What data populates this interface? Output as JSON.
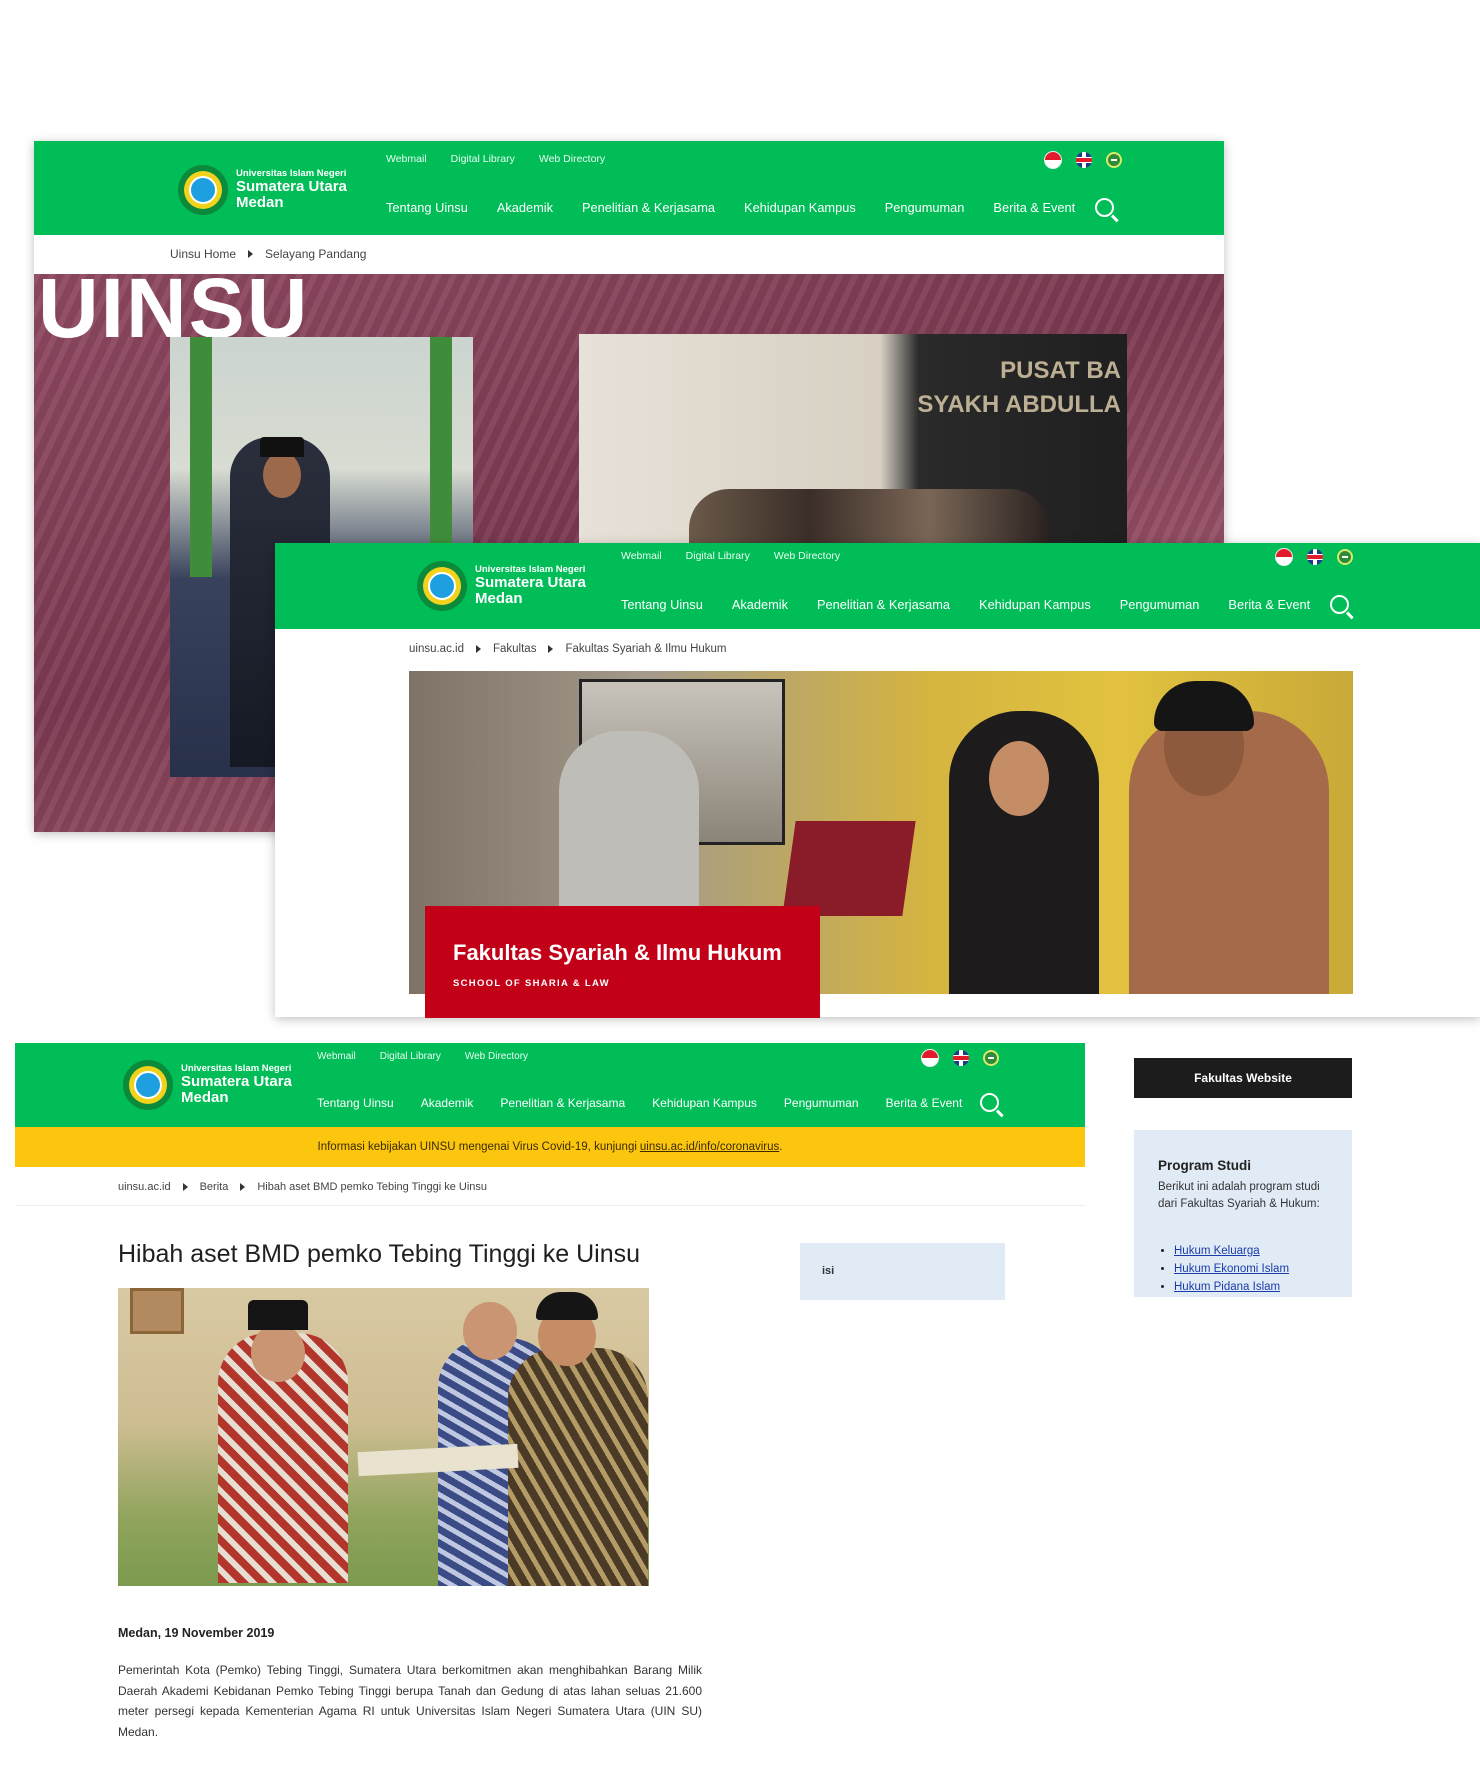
{
  "nav": {
    "logo": {
      "line1": "Universitas Islam Negeri",
      "line2": "Sumatera Utara",
      "line3": "Medan"
    },
    "top_links": [
      "Webmail",
      "Digital Library",
      "Web Directory"
    ],
    "main_links": [
      "Tentang Uinsu",
      "Akademik",
      "Penelitian & Kerjasama",
      "Kehidupan Kampus",
      "Pengumuman",
      "Berita & Event"
    ],
    "languages": [
      "id-flag-icon",
      "uk-flag-icon",
      "saudi-flag-icon"
    ]
  },
  "panel1": {
    "breadcrumb": [
      "Uinsu Home",
      "Selayang Pandang"
    ],
    "hero_watermark": "UINSU",
    "photo_text": "PUSAT BA\nSYAKH ABDULLA"
  },
  "panel2": {
    "breadcrumb": [
      "uinsu.ac.id",
      "Fakultas",
      "Fakultas Syariah & Ilmu Hukum"
    ],
    "faculty_title": "Fakultas Syariah & Ilmu Hukum",
    "faculty_subtitle": "SCHOOL OF SHARIA & LAW"
  },
  "panel3": {
    "covid_notice": "Informasi kebijakan UINSU mengenai Virus Covid-19, kunjungi",
    "covid_link": "uinsu.ac.id/info/coronavirus",
    "covid_end": ".",
    "breadcrumb": [
      "uinsu.ac.id",
      "Berita",
      "Hibah aset BMD pemko Tebing Tinggi ke Uinsu"
    ],
    "article_title": "Hibah aset BMD pemko Tebing Tinggi ke Uinsu",
    "article_date": "Medan, 19 November 2019",
    "article_body": "Pemerintah Kota (Pemko) Tebing Tinggi, Sumatera Utara berkomitmen akan menghibahkan Barang Milik Daerah Akademi Kebidanan Pemko Tebing Tinggi berupa Tanah dan Gedung di atas lahan seluas 21.600 meter persegi kepada Kementerian Agama RI untuk Universitas Islam Negeri Sumatera Utara (UIN SU) Medan.",
    "side_box_label": "isi"
  },
  "sidebar": {
    "faculty_button": "Fakultas Website",
    "program_heading": "Program Studi",
    "program_desc": "Berikut ini adalah program studi dari Fakultas Syariah & Hukum:",
    "programs": [
      "Hukum Keluarga",
      "Hukum Ekonomi Islam",
      "Hukum Pidana Islam"
    ]
  },
  "colors": {
    "brand_green": "#00bd58",
    "alert_yellow": "#fcc60f",
    "faculty_red": "#c20017",
    "hero_maroon": "#8f4a62",
    "panel_blue": "#e1ebf6"
  }
}
